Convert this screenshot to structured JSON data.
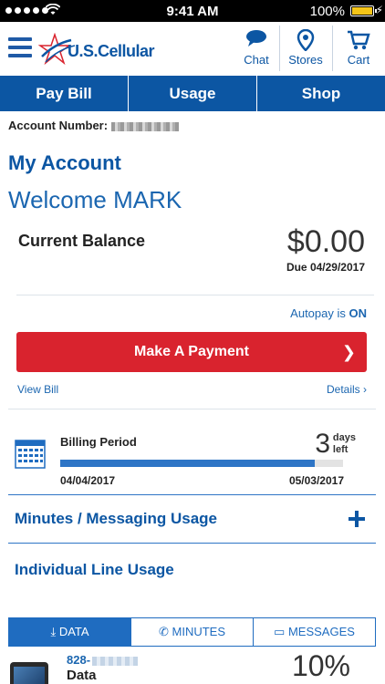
{
  "status_bar": {
    "time": "9:41 AM",
    "battery_percent": "100%",
    "signal_icon": "signal-dots-icon",
    "wifi_icon": "wifi-icon",
    "battery_icon": "battery-icon",
    "battery_color": "#f5c518"
  },
  "header": {
    "logo_text": "U.S.Cellular",
    "chat_label": "Chat",
    "stores_label": "Stores",
    "cart_label": "Cart",
    "brand_color": "#0c56a3"
  },
  "nav_tabs": [
    "Pay Bill",
    "Usage",
    "Shop"
  ],
  "account": {
    "number_label": "Account Number:",
    "title": "My Account",
    "welcome": "Welcome MARK"
  },
  "balance": {
    "label": "Current Balance",
    "amount": "$0.00",
    "due": "Due 04/29/2017",
    "autopay_prefix": "Autopay is",
    "autopay_state": "ON",
    "pay_button": "Make A Payment",
    "pay_button_chevron": "❯",
    "pay_button_color": "#d9232e",
    "view_bill": "View Bill",
    "details": "Details ›"
  },
  "billing_period": {
    "label": "Billing Period",
    "days_left_number": "3",
    "days_left_unit_1": "days",
    "days_left_unit_2": "left",
    "start_date": "04/04/2017",
    "end_date": "05/03/2017",
    "elapsed_fraction": 0.9
  },
  "sections": {
    "minutes_messaging": "Minutes / Messaging  Usage",
    "individual_line": "Individual Line Usage"
  },
  "usage_tabs": [
    {
      "label": "DATA",
      "icon": "download-icon",
      "active": true
    },
    {
      "label": "MINUTES",
      "icon": "phone-icon",
      "active": false
    },
    {
      "label": "MESSAGES",
      "icon": "message-icon",
      "active": false
    }
  ],
  "line": {
    "number_prefix": "828-",
    "type": "Data",
    "percent": "10%"
  }
}
